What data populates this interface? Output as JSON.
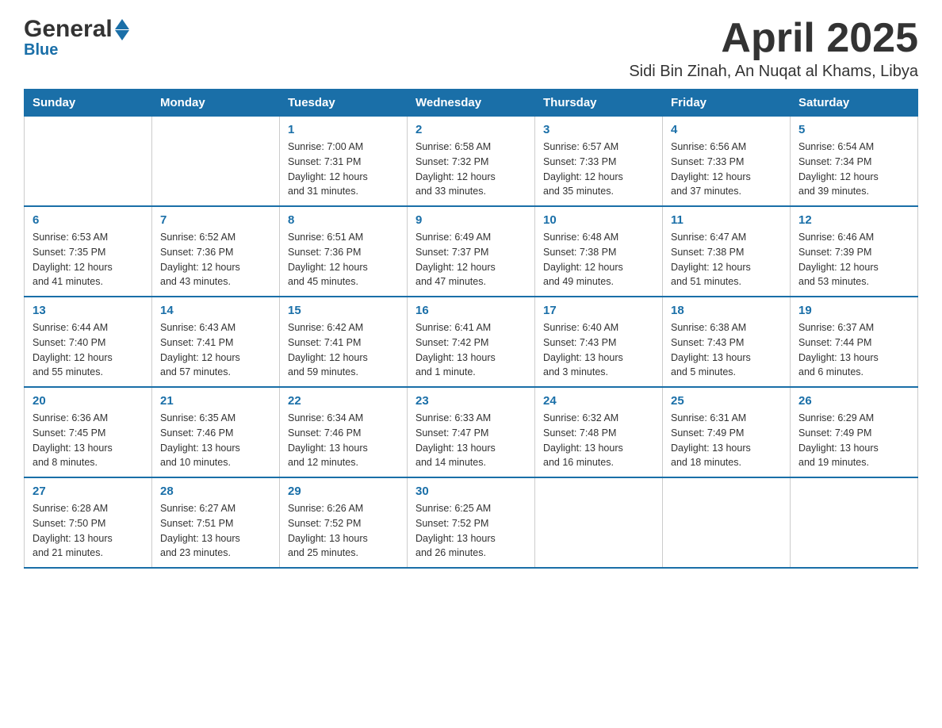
{
  "logo": {
    "general": "General",
    "blue": "Blue"
  },
  "title": "April 2025",
  "subtitle": "Sidi Bin Zinah, An Nuqat al Khams, Libya",
  "weekdays": [
    "Sunday",
    "Monday",
    "Tuesday",
    "Wednesday",
    "Thursday",
    "Friday",
    "Saturday"
  ],
  "weeks": [
    [
      {
        "day": "",
        "info": ""
      },
      {
        "day": "",
        "info": ""
      },
      {
        "day": "1",
        "info": "Sunrise: 7:00 AM\nSunset: 7:31 PM\nDaylight: 12 hours\nand 31 minutes."
      },
      {
        "day": "2",
        "info": "Sunrise: 6:58 AM\nSunset: 7:32 PM\nDaylight: 12 hours\nand 33 minutes."
      },
      {
        "day": "3",
        "info": "Sunrise: 6:57 AM\nSunset: 7:33 PM\nDaylight: 12 hours\nand 35 minutes."
      },
      {
        "day": "4",
        "info": "Sunrise: 6:56 AM\nSunset: 7:33 PM\nDaylight: 12 hours\nand 37 minutes."
      },
      {
        "day": "5",
        "info": "Sunrise: 6:54 AM\nSunset: 7:34 PM\nDaylight: 12 hours\nand 39 minutes."
      }
    ],
    [
      {
        "day": "6",
        "info": "Sunrise: 6:53 AM\nSunset: 7:35 PM\nDaylight: 12 hours\nand 41 minutes."
      },
      {
        "day": "7",
        "info": "Sunrise: 6:52 AM\nSunset: 7:36 PM\nDaylight: 12 hours\nand 43 minutes."
      },
      {
        "day": "8",
        "info": "Sunrise: 6:51 AM\nSunset: 7:36 PM\nDaylight: 12 hours\nand 45 minutes."
      },
      {
        "day": "9",
        "info": "Sunrise: 6:49 AM\nSunset: 7:37 PM\nDaylight: 12 hours\nand 47 minutes."
      },
      {
        "day": "10",
        "info": "Sunrise: 6:48 AM\nSunset: 7:38 PM\nDaylight: 12 hours\nand 49 minutes."
      },
      {
        "day": "11",
        "info": "Sunrise: 6:47 AM\nSunset: 7:38 PM\nDaylight: 12 hours\nand 51 minutes."
      },
      {
        "day": "12",
        "info": "Sunrise: 6:46 AM\nSunset: 7:39 PM\nDaylight: 12 hours\nand 53 minutes."
      }
    ],
    [
      {
        "day": "13",
        "info": "Sunrise: 6:44 AM\nSunset: 7:40 PM\nDaylight: 12 hours\nand 55 minutes."
      },
      {
        "day": "14",
        "info": "Sunrise: 6:43 AM\nSunset: 7:41 PM\nDaylight: 12 hours\nand 57 minutes."
      },
      {
        "day": "15",
        "info": "Sunrise: 6:42 AM\nSunset: 7:41 PM\nDaylight: 12 hours\nand 59 minutes."
      },
      {
        "day": "16",
        "info": "Sunrise: 6:41 AM\nSunset: 7:42 PM\nDaylight: 13 hours\nand 1 minute."
      },
      {
        "day": "17",
        "info": "Sunrise: 6:40 AM\nSunset: 7:43 PM\nDaylight: 13 hours\nand 3 minutes."
      },
      {
        "day": "18",
        "info": "Sunrise: 6:38 AM\nSunset: 7:43 PM\nDaylight: 13 hours\nand 5 minutes."
      },
      {
        "day": "19",
        "info": "Sunrise: 6:37 AM\nSunset: 7:44 PM\nDaylight: 13 hours\nand 6 minutes."
      }
    ],
    [
      {
        "day": "20",
        "info": "Sunrise: 6:36 AM\nSunset: 7:45 PM\nDaylight: 13 hours\nand 8 minutes."
      },
      {
        "day": "21",
        "info": "Sunrise: 6:35 AM\nSunset: 7:46 PM\nDaylight: 13 hours\nand 10 minutes."
      },
      {
        "day": "22",
        "info": "Sunrise: 6:34 AM\nSunset: 7:46 PM\nDaylight: 13 hours\nand 12 minutes."
      },
      {
        "day": "23",
        "info": "Sunrise: 6:33 AM\nSunset: 7:47 PM\nDaylight: 13 hours\nand 14 minutes."
      },
      {
        "day": "24",
        "info": "Sunrise: 6:32 AM\nSunset: 7:48 PM\nDaylight: 13 hours\nand 16 minutes."
      },
      {
        "day": "25",
        "info": "Sunrise: 6:31 AM\nSunset: 7:49 PM\nDaylight: 13 hours\nand 18 minutes."
      },
      {
        "day": "26",
        "info": "Sunrise: 6:29 AM\nSunset: 7:49 PM\nDaylight: 13 hours\nand 19 minutes."
      }
    ],
    [
      {
        "day": "27",
        "info": "Sunrise: 6:28 AM\nSunset: 7:50 PM\nDaylight: 13 hours\nand 21 minutes."
      },
      {
        "day": "28",
        "info": "Sunrise: 6:27 AM\nSunset: 7:51 PM\nDaylight: 13 hours\nand 23 minutes."
      },
      {
        "day": "29",
        "info": "Sunrise: 6:26 AM\nSunset: 7:52 PM\nDaylight: 13 hours\nand 25 minutes."
      },
      {
        "day": "30",
        "info": "Sunrise: 6:25 AM\nSunset: 7:52 PM\nDaylight: 13 hours\nand 26 minutes."
      },
      {
        "day": "",
        "info": ""
      },
      {
        "day": "",
        "info": ""
      },
      {
        "day": "",
        "info": ""
      }
    ]
  ]
}
